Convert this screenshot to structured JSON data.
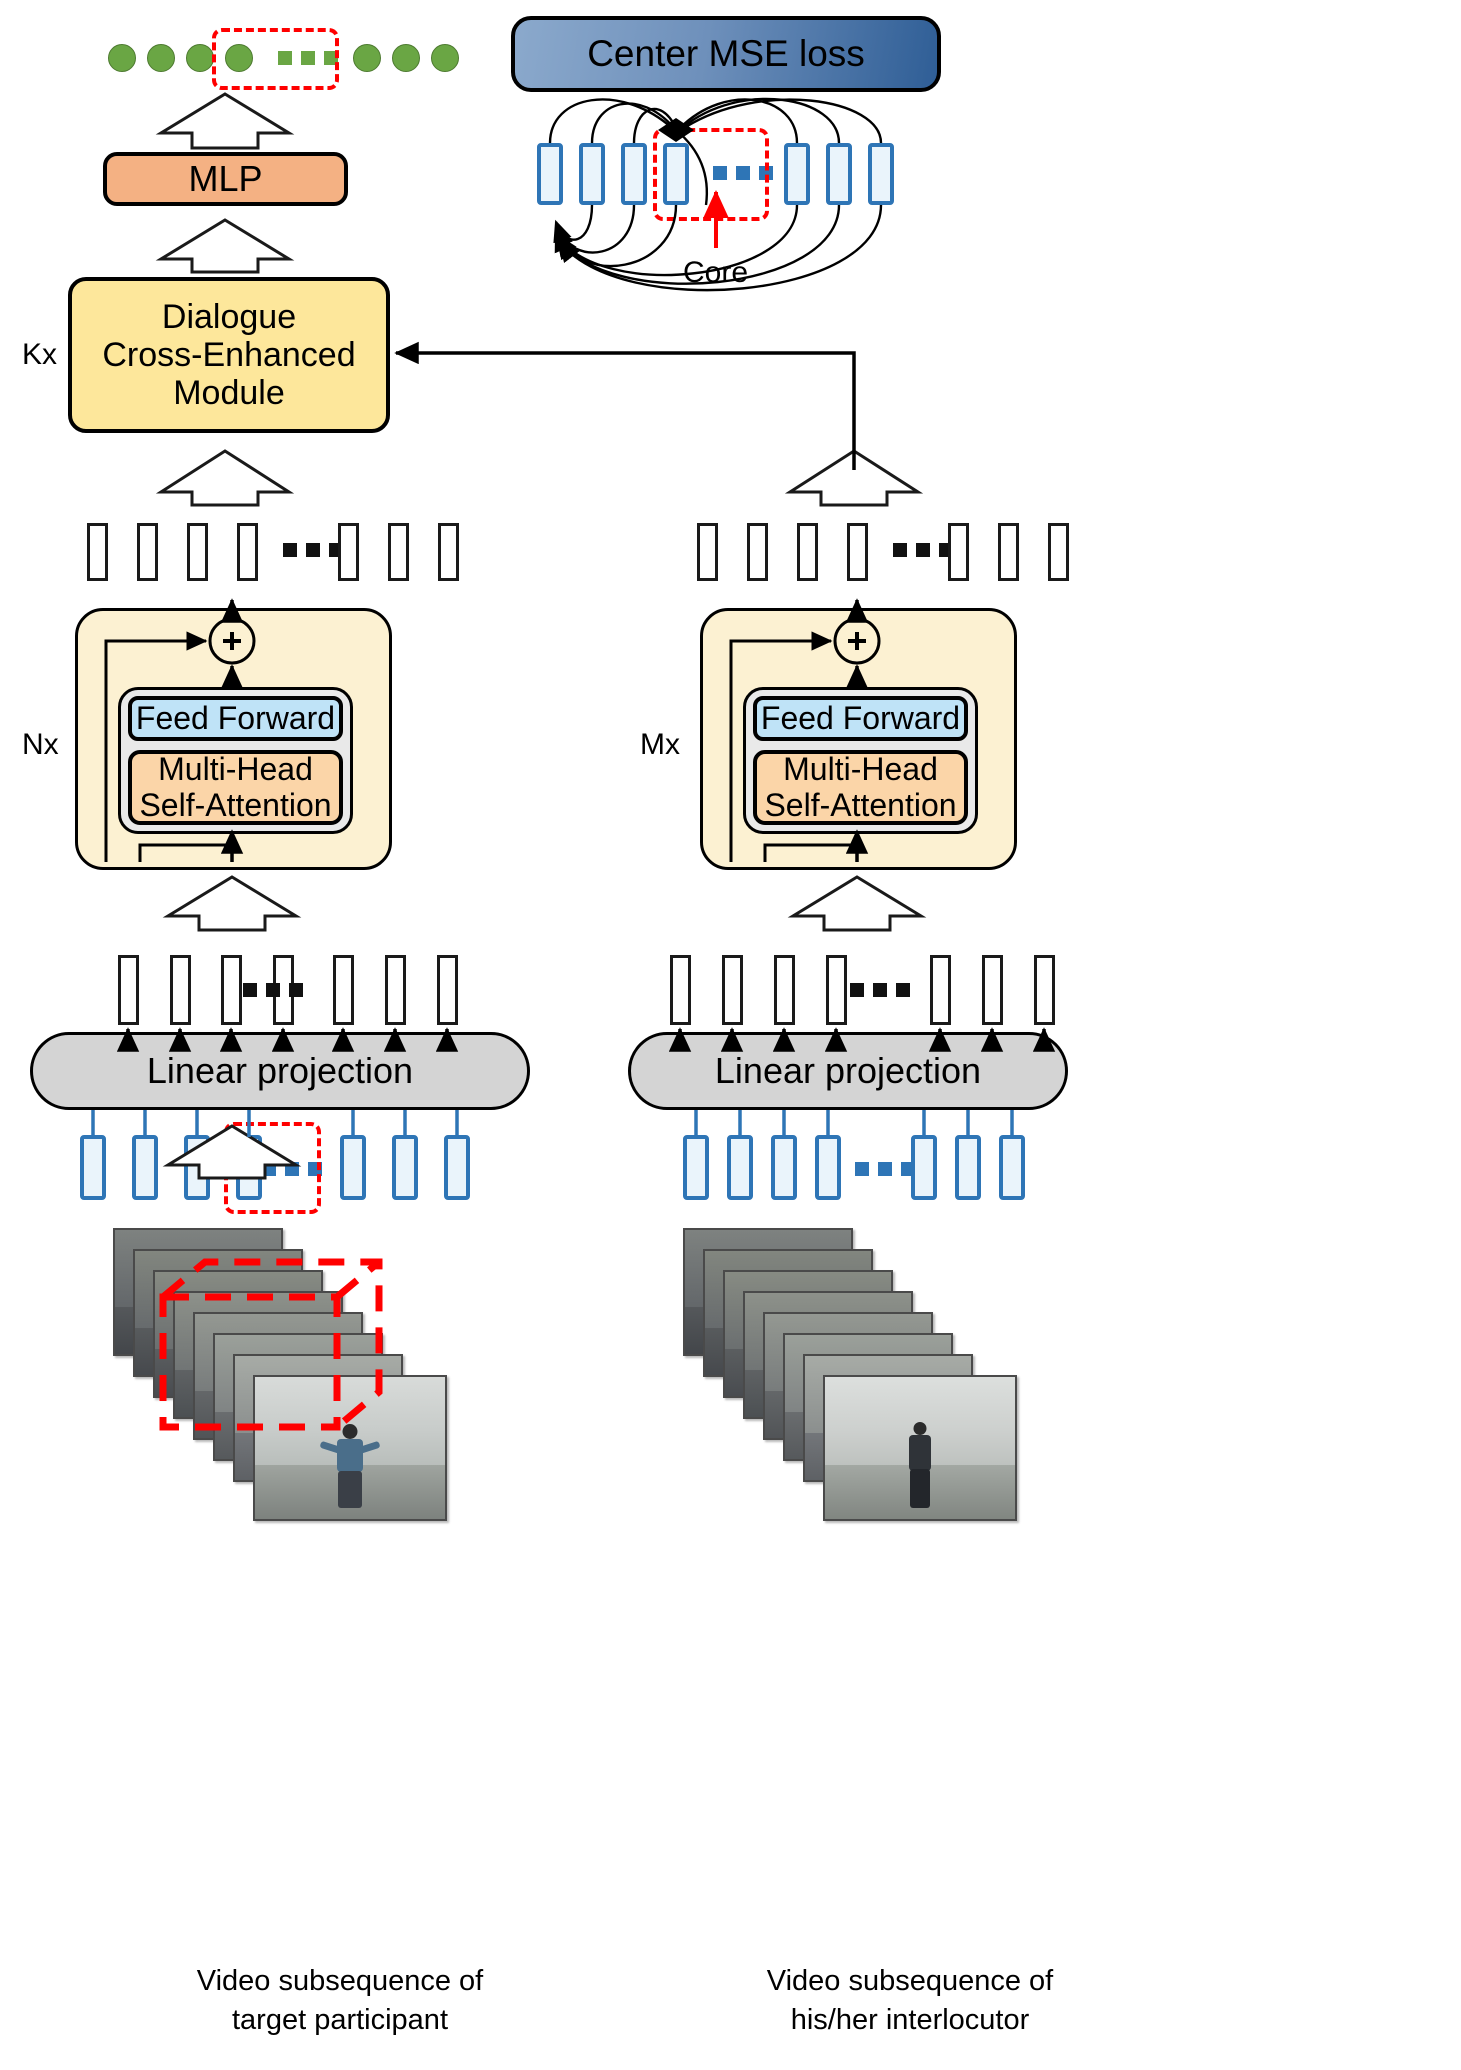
{
  "diagram": {
    "title": "Dialogue cross-enhanced transformer architecture",
    "blocks": {
      "mlp": "MLP",
      "center_loss": "Center MSE loss",
      "dialogue_module": "Dialogue\nCross-Enhanced\nModule",
      "dialogue_module_line1": "Dialogue",
      "dialogue_module_line2": "Cross-Enhanced",
      "dialogue_module_line3": "Module",
      "feed_forward": "Feed Forward",
      "mhsa_line1": "Multi-Head",
      "mhsa_line2": "Self-Attention",
      "linear_projection": "Linear projection"
    },
    "repeat_labels": {
      "dialogue": "Kx",
      "left_transformer": "Nx",
      "right_transformer": "Mx"
    },
    "annotations": {
      "core": "Core"
    },
    "captions": {
      "left_line1": "Video subsequence of",
      "left_line2": "target participant",
      "right_line1": "Video subsequence of",
      "right_line2": "his/her interlocutor"
    },
    "colors": {
      "mlp_fill": "#f4b183",
      "loss_fill_start": "#8ba9cc",
      "loss_fill_end": "#2f5e96",
      "dialogue_fill": "#fde79b",
      "feed_forward_fill": "#bfe3f7",
      "mhsa_fill": "#fbd5a8",
      "transformer_outer_fill": "#fcf1d2",
      "transformer_mid_fill": "#e9e9e9",
      "linear_projection_fill": "#d4d4d4",
      "token_blue_stroke": "#2e75b6",
      "token_blue_fill": "#eaf4fb",
      "output_circle": "#6aa644",
      "highlight_dashed": "#ff0000",
      "outline": "#000000"
    },
    "counts": {
      "output_circles": 8,
      "loss_tokens": 8,
      "left_top_tokens": 7,
      "left_bottom_tokens": 7,
      "left_patch_tokens": 7,
      "right_top_tokens": 7,
      "right_bottom_tokens": 7,
      "right_patch_tokens": 7,
      "left_video_frames": 8,
      "right_video_frames": 8
    },
    "ellipsis_symbol": "..."
  }
}
